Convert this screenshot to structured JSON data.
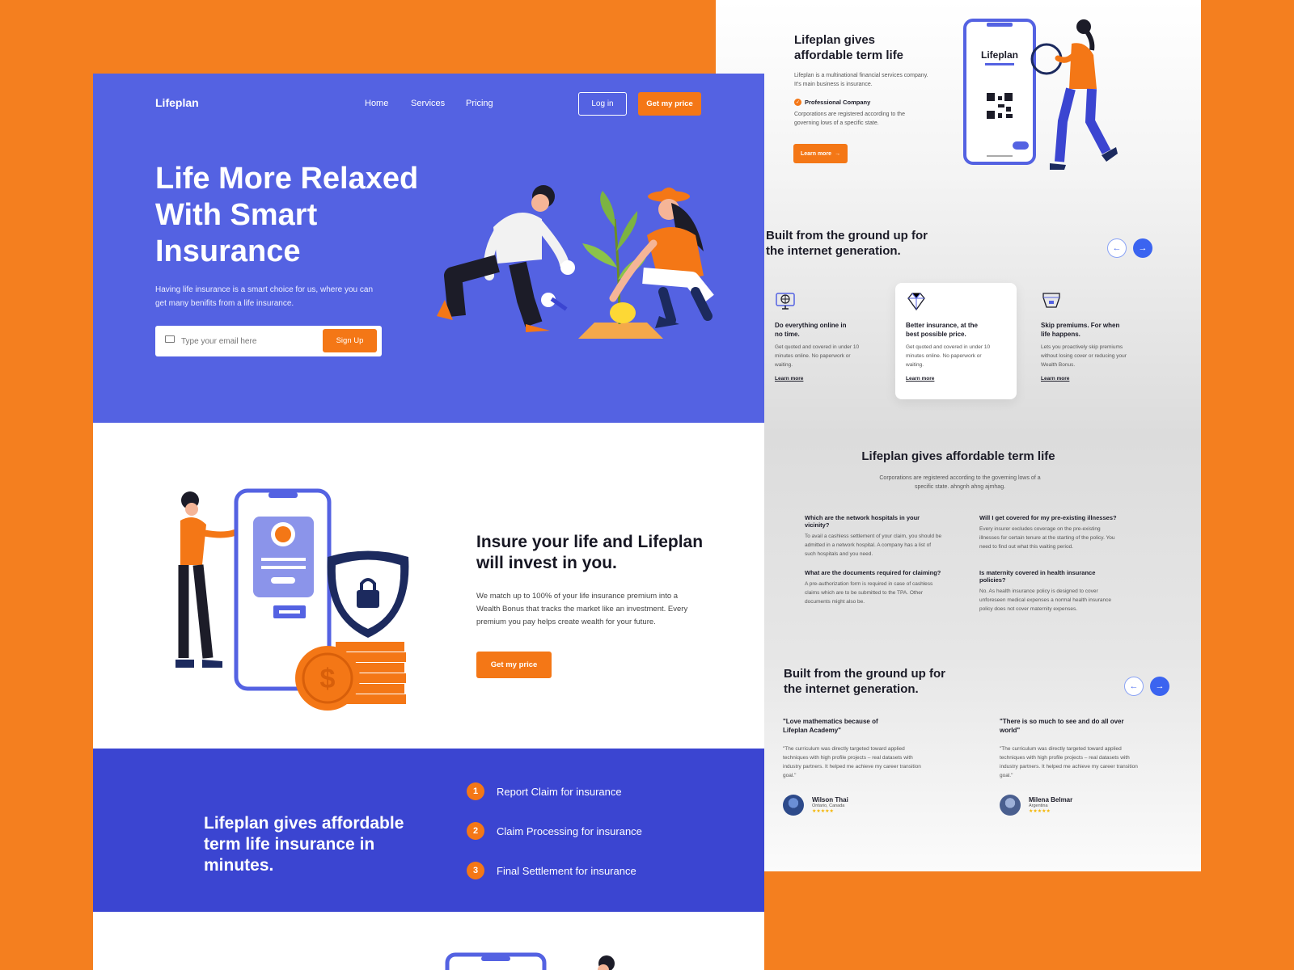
{
  "colors": {
    "background": "#f47f1f",
    "primary": "#5462e2",
    "primary_dark": "#3b45d1",
    "accent": "#f47716",
    "text_dark": "#1c1c28"
  },
  "right_page": {
    "top": {
      "title": "Lifeplan gives affordable term life",
      "description": "Lifeplan is a multinational financial services company. It's main business is insurance.",
      "badge": "Professional Company",
      "badge_text": "Corporations are registered according to the governing lows of a specific state.",
      "button": "Learn more",
      "phone_brand": "Lifeplan"
    },
    "features_section": {
      "title": "Built from the ground up for the internet generation.",
      "cards": [
        {
          "icon": "monitor-globe-icon",
          "title": "Do everything online in no time.",
          "text": "Get quoted and covered in under 10 minutes online. No paperwork or waiting.",
          "link": "Learn more"
        },
        {
          "icon": "diamond-icon",
          "title": "Better insurance, at the best possible price.",
          "text": "Get quoted and covered in under 10 minutes online. No paperwork or waiting.",
          "link": "Learn more"
        },
        {
          "icon": "wallet-icon",
          "title": "Skip premiums. For when life happens.",
          "text": "Lets you proactively skip premiums without losing cover or reducing your Wealth Bonus.",
          "link": "Learn more"
        }
      ]
    },
    "faq_section": {
      "title": "Lifeplan gives affordable term life",
      "subtitle": "Corporations are registered according to the governing lows of a specific state. ahngnh ahng ajmhag.",
      "items": [
        {
          "q": "Which are the network hospitals in your vicinity?",
          "a": "To avail a cashless settlement of your claim, you should be admitted in a network hospital. A company has a list of such hospitals and you need."
        },
        {
          "q": "Will I get covered for my pre-existing illnesses?",
          "a": "Every insurer excludes coverage on the pre-existing illnesses for certain tenure at the starting of the policy. You need to find out what this waiting period."
        },
        {
          "q": "What are the documents required for claiming?",
          "a": "A pre-authorization form is required in case of cashless claims which are to be submitted to the TPA. Other documents might also be."
        },
        {
          "q": "Is maternity covered in health insurance policies?",
          "a": "No. As health insurance policy is designed to cover unforeseen medical expenses a normal health insurance policy does not cover maternity expenses."
        }
      ]
    },
    "testimonials_section": {
      "title": "Built from the ground up for the internet generation.",
      "items": [
        {
          "quote_title": "\"Love mathematics because of Lifeplan Academy\"",
          "text": "\"The curriculum was directly targeted toward applied techniques with high profile projects – real datasets with industry partners. It helped me achieve my career transition goal.\"",
          "name": "Wilson Thai",
          "location": "Ontario, Canada",
          "stars": "★★★★★"
        },
        {
          "quote_title": "\"There is so much to see and do all over world\"",
          "text": "\"The curriculum was directly targeted toward applied techniques with high profile projects – real datasets with industry partners. It helped me achieve my career transition goal.\"",
          "name": "Milena Belmar",
          "location": "Argentina",
          "stars": "★★★★★"
        }
      ]
    }
  },
  "left_page": {
    "brand": "Lifeplan",
    "nav": {
      "home": "Home",
      "services": "Services",
      "pricing": "Pricing",
      "login": "Log in",
      "cta": "Get my price"
    },
    "hero": {
      "title": "Life More Relaxed With Smart Insurance",
      "subtitle": "Having life insurance is a smart choice for us, where you can get many benifits from a life insurance.",
      "email_placeholder": "Type your email here",
      "signup": "Sign Up"
    },
    "section2": {
      "title": "Insure your life and Lifeplan will invest in you.",
      "text": "We match up to 100% of your life insurance premium into a Wealth Bonus that tracks the market like an investment. Every premium you pay helps create wealth for your future.",
      "button": "Get my price"
    },
    "steps": {
      "title": "Lifeplan gives affordable term life insurance in minutes.",
      "items": [
        {
          "num": "1",
          "label": "Report Claim for insurance"
        },
        {
          "num": "2",
          "label": "Claim Processing for insurance"
        },
        {
          "num": "3",
          "label": "Final Settlement for insurance"
        }
      ]
    }
  }
}
